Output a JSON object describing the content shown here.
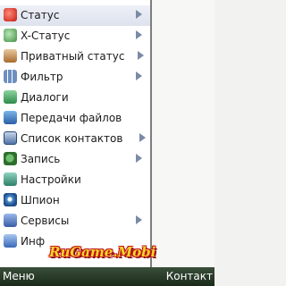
{
  "menu": {
    "items": [
      {
        "label": "Статус",
        "icon": "status-flower-icon",
        "submenu": true
      },
      {
        "label": "X-Статус",
        "icon": "x-status-icon",
        "submenu": true
      },
      {
        "label": "Приватный статус",
        "icon": "private-status-icon",
        "submenu": true
      },
      {
        "label": "Фильтр",
        "icon": "filter-icon",
        "submenu": true
      },
      {
        "label": "Диалоги",
        "icon": "dialogs-icon",
        "submenu": false
      },
      {
        "label": "Передачи файлов",
        "icon": "file-transfer-icon",
        "submenu": false
      },
      {
        "label": "Список контактов",
        "icon": "contact-list-icon",
        "submenu": true
      },
      {
        "label": "Запись",
        "icon": "record-icon",
        "submenu": true
      },
      {
        "label": "Настройки",
        "icon": "settings-icon",
        "submenu": false
      },
      {
        "label": "Шпион",
        "icon": "spy-icon",
        "submenu": false
      },
      {
        "label": "Сервисы",
        "icon": "services-icon",
        "submenu": true
      },
      {
        "label": "Инф",
        "icon": "info-icon",
        "submenu": false
      }
    ]
  },
  "watermark": "RuGame.Mobi",
  "softkeys": {
    "left": "Меню",
    "right": "Контакт"
  },
  "colors": {
    "softbar": "#1a2a1a",
    "menu_border": "#7e7e7e",
    "watermark_fill": "#f6d52a",
    "watermark_outline": "#c0151b"
  }
}
